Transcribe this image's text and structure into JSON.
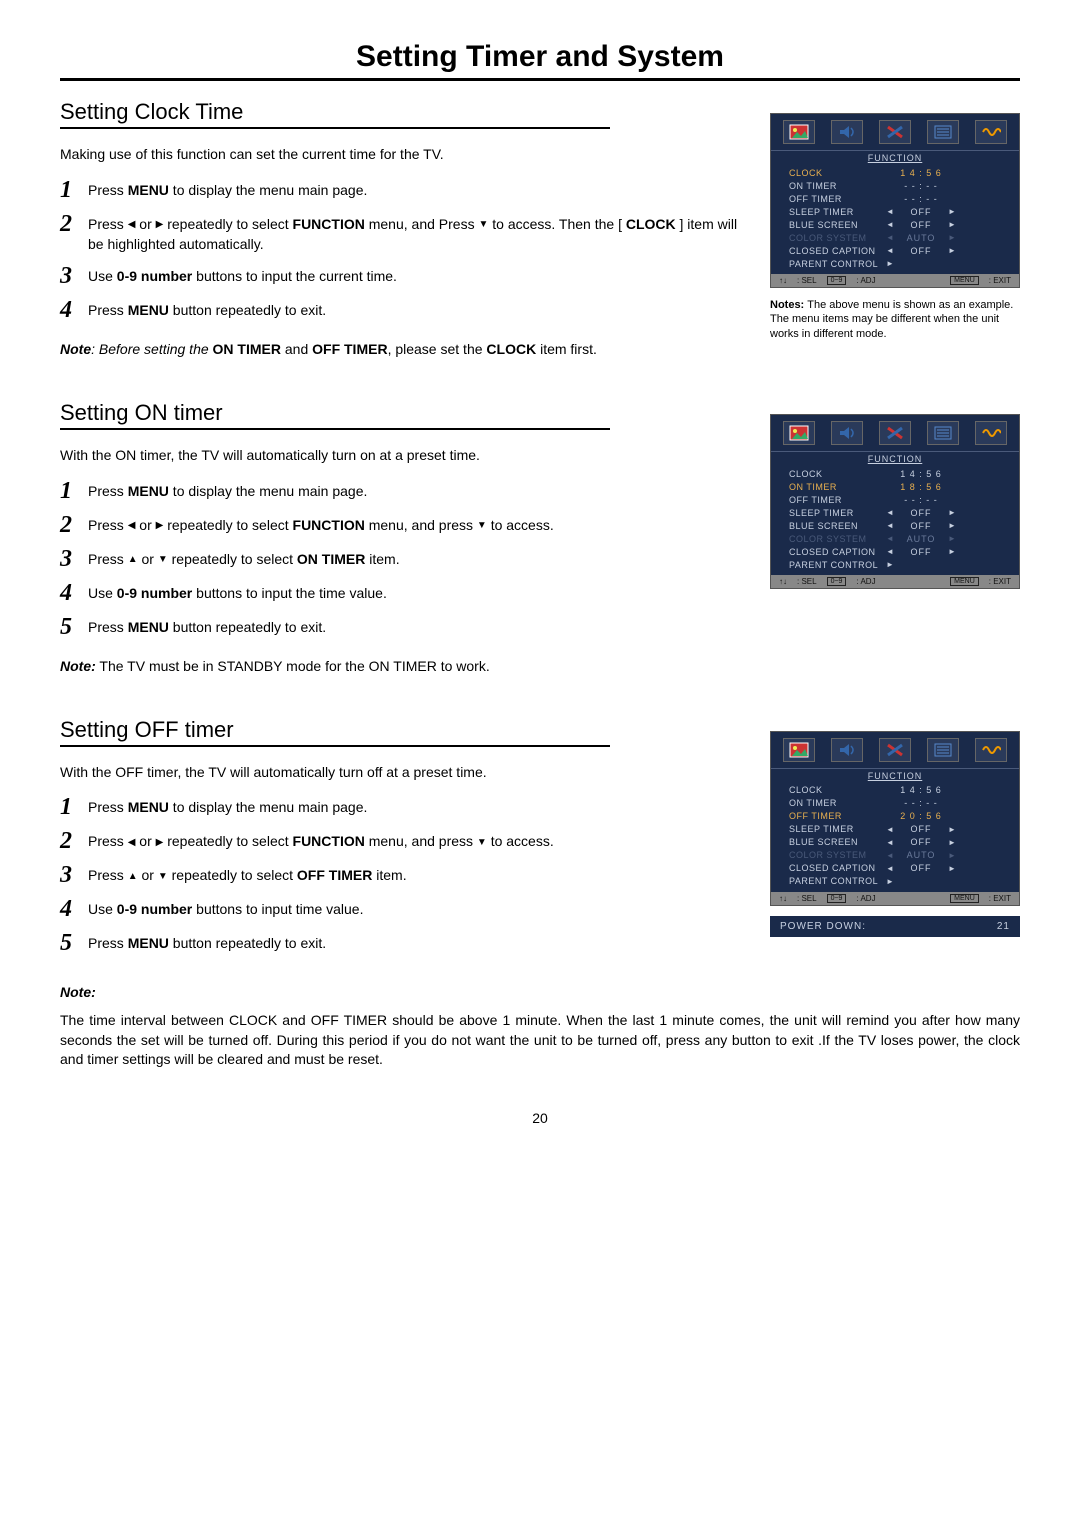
{
  "page_title": "Setting Timer and System",
  "page_number": "20",
  "section1": {
    "heading": "Setting Clock Time",
    "intro": "Making use of this function can set the current time for the TV.",
    "steps": {
      "s1_pre": "Press ",
      "s1_bold": "MENU",
      "s1_post": " to display the menu main page.",
      "s2_pre": "Press ",
      "s2_mid": " or ",
      "s2_mid2": " repeatedly to select ",
      "s2_bold": "FUNCTION",
      "s2_post": " menu, and Press ",
      "s2_end": " to access. Then the [ ",
      "s2_bold2": "CLOCK",
      "s2_end2": " ] item will be highlighted automatically.",
      "s3_pre": "Use ",
      "s3_bold": "0-9 number",
      "s3_post": " buttons to input the current time.",
      "s4_pre": "Press ",
      "s4_bold": "MENU",
      "s4_post": "  button repeatedly to exit."
    },
    "note_label": "Note",
    "note_text1": ": Before setting the ",
    "note_bold1": "ON TIMER",
    "note_text2": " and ",
    "note_bold2": "OFF TIMER",
    "note_text3": ", please set the ",
    "note_bold3": "CLOCK",
    "note_text4": " item first.",
    "menu_footer_sel": " : SEL",
    "menu_footer_adj": " : ADJ",
    "menu_footer_exit": " : EXIT",
    "notes_caption": "Notes: ",
    "notes_text": "The above menu is shown as an example. The menu items may be different when the unit works in different mode."
  },
  "section2": {
    "heading": "Setting ON timer",
    "intro": "With the ON timer, the TV will automatically turn on at a preset time.",
    "steps": {
      "s1_pre": "Press ",
      "s1_bold": "MENU",
      "s1_post": " to display the menu main page.",
      "s2_pre": "Press ",
      "s2_mid": " or ",
      "s2_mid2": " repeatedly to select ",
      "s2_bold": "FUNCTION",
      "s2_post": " menu, and press ",
      "s2_end": " to access.",
      "s3_pre": "Press  ",
      "s3_mid": " or ",
      "s3_mid2": " repeatedly to select ",
      "s3_bold": "ON TIMER",
      "s3_post": " item.",
      "s4_pre": "Use ",
      "s4_bold": "0-9 number",
      "s4_post": " buttons to input the time value.",
      "s5_pre": "Press ",
      "s5_bold": "MENU",
      "s5_post": "  button repeatedly to exit."
    },
    "note_label": "Note:",
    "note_text": " The TV must be in STANDBY mode for the ON TIMER to work."
  },
  "section3": {
    "heading": "Setting OFF timer",
    "intro": "With the OFF timer, the TV will automatically turn off at a preset time.",
    "steps": {
      "s1_pre": "Press ",
      "s1_bold": "MENU",
      "s1_post": " to display the menu main page.",
      "s2_pre": "Press ",
      "s2_mid": " or ",
      "s2_mid2": " repeatedly to select ",
      "s2_bold": "FUNCTION",
      "s2_post": " menu, and press ",
      "s2_end": " to access.",
      "s3_pre": "Press  ",
      "s3_mid": " or ",
      "s3_mid2": " repeatedly to select  ",
      "s3_bold": "OFF TIMER",
      "s3_post": "  item.",
      "s4_pre": "Use ",
      "s4_bold": "0-9 number",
      "s4_post": " buttons to input time value.",
      "s5_pre": "Press ",
      "s5_bold": "MENU",
      "s5_post": "  button repeatedly to exit."
    },
    "final_note_label": "Note:",
    "final_note_text": "The time interval between CLOCK and OFF TIMER should be above 1 minute. When the last 1 minute comes, the unit will remind you after how many seconds the set will be turned off. During this period if you do not want the unit to be turned off, press any button to exit .If the TV loses power, the clock and timer settings will be cleared and must be reset.",
    "banner_label": "POWER   DOWN:",
    "banner_value": "21"
  },
  "menu_common": {
    "subtitle": "FUNCTION",
    "labels": {
      "clock": "CLOCK",
      "on_timer": "ON  TIMER",
      "off_timer": "OFF  TIMER",
      "sleep_timer": "SLEEP  TIMER",
      "blue_screen": "BLUE  SCREEN",
      "color_system": "COLOR  SYSTEM",
      "closed_caption": "CLOSED  CAPTION",
      "parent_control": "PARENT CONTROL"
    },
    "vals": {
      "off": "OFF",
      "auto": "AUTO",
      "blank": "- - : - -"
    },
    "footer_09": "0~9",
    "footer_menu": "MENU"
  },
  "menu1": {
    "clock_val": "1 4 : 5 6",
    "on_val": "- - : - -",
    "off_val": "- - : - -"
  },
  "menu2": {
    "clock_val": "1 4 : 5 6",
    "on_val": "1 8 : 5 6",
    "off_val": "- - : - -"
  },
  "menu3": {
    "clock_val": "1 4 : 5 6",
    "on_val": "- - : - -",
    "off_val": "2 0 : 5 6"
  }
}
